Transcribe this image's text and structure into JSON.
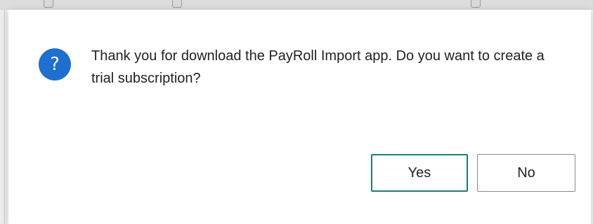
{
  "dialog": {
    "icon": "question-icon",
    "message": "Thank you for download the PayRoll Import app. Do you want to create a trial subscription?",
    "buttons": {
      "yes_label": "Yes",
      "no_label": "No"
    },
    "colors": {
      "icon_background": "#1e6fcf",
      "primary_focus_border": "#1b7c78"
    }
  }
}
